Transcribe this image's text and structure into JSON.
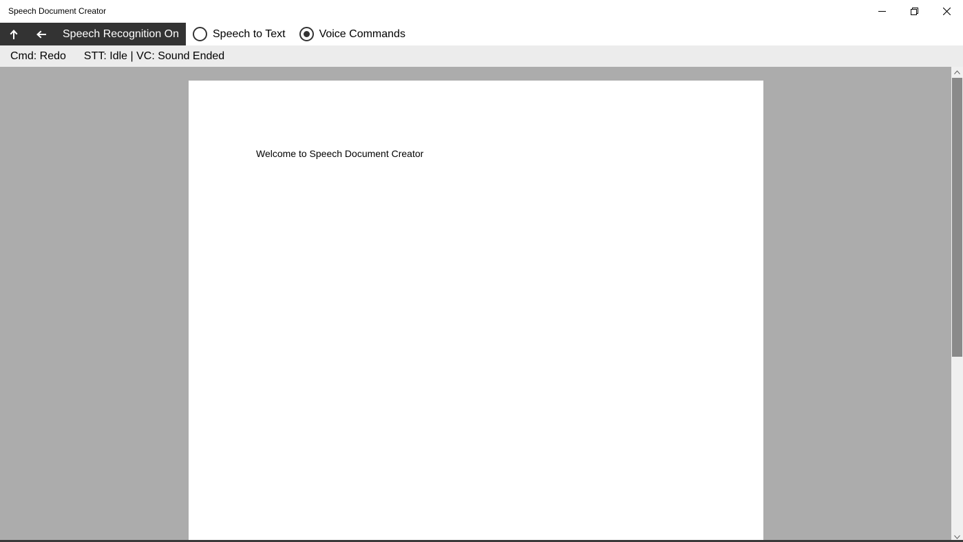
{
  "window": {
    "title": "Speech Document Creator"
  },
  "toolbar": {
    "up_icon": "arrow-up-icon",
    "back_icon": "arrow-left-icon",
    "recognition_label": "Speech Recognition On",
    "modes": [
      {
        "label": "Speech to Text",
        "selected": false
      },
      {
        "label": "Voice Commands",
        "selected": true
      }
    ]
  },
  "status": {
    "command": "Cmd: Redo",
    "state": "STT: Idle | VC: Sound Ended"
  },
  "document": {
    "text": "Welcome to Speech Document Creator"
  },
  "colors": {
    "toolbar_dark": "#333333",
    "workspace_bg": "#acacac",
    "status_bg": "#ececec"
  }
}
